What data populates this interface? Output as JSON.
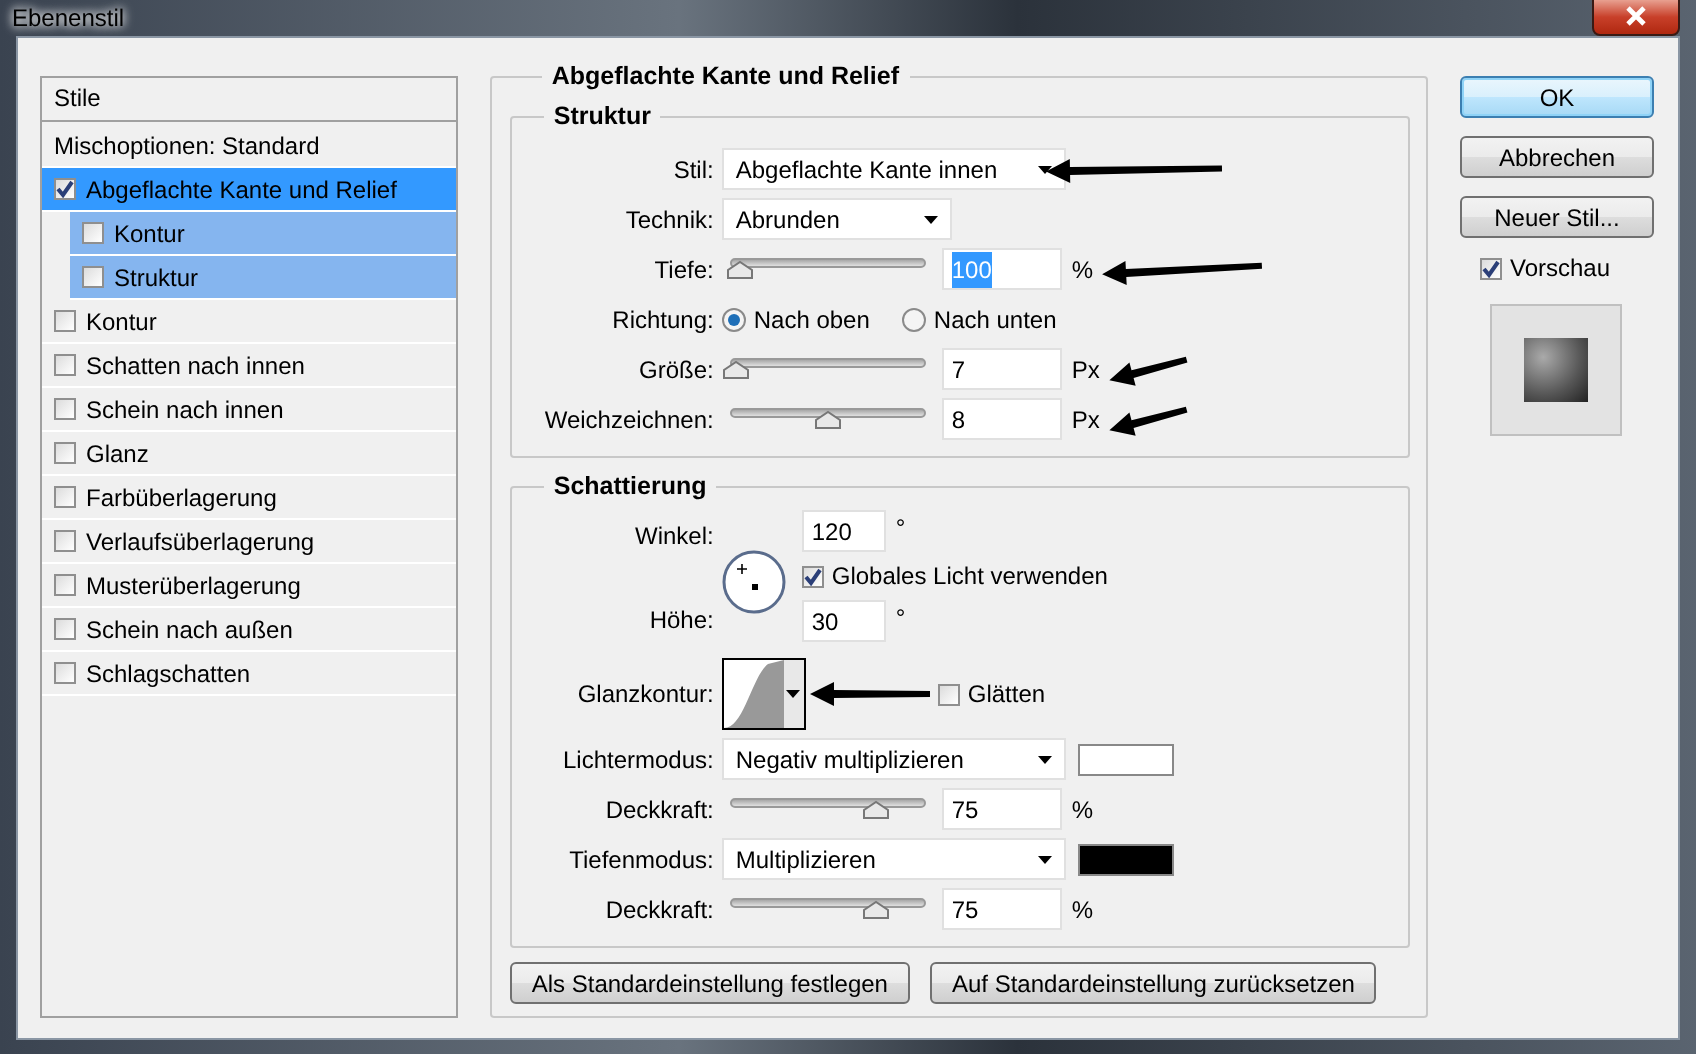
{
  "window": {
    "title": "Ebenenstil"
  },
  "styles_panel": {
    "header": "Stile",
    "items": [
      {
        "label": "Mischoptionen: Standard",
        "kind": "plain",
        "selected": false
      },
      {
        "label": "Abgeflachte Kante und Relief",
        "kind": "check",
        "checked": true,
        "selected": true,
        "children": [
          {
            "label": "Kontur",
            "kind": "check",
            "checked": false,
            "selected": false
          },
          {
            "label": "Struktur",
            "kind": "check",
            "checked": false,
            "selected": false
          }
        ]
      },
      {
        "label": "Kontur",
        "kind": "check",
        "checked": false,
        "selected": false
      },
      {
        "label": "Schatten nach innen",
        "kind": "check",
        "checked": false,
        "selected": false
      },
      {
        "label": "Schein nach innen",
        "kind": "check",
        "checked": false,
        "selected": false
      },
      {
        "label": "Glanz",
        "kind": "check",
        "checked": false,
        "selected": false
      },
      {
        "label": "Farbüberlagerung",
        "kind": "check",
        "checked": false,
        "selected": false
      },
      {
        "label": "Verlaufsüberlagerung",
        "kind": "check",
        "checked": false,
        "selected": false
      },
      {
        "label": "Musterüberlagerung",
        "kind": "check",
        "checked": false,
        "selected": false
      },
      {
        "label": "Schein nach außen",
        "kind": "check",
        "checked": false,
        "selected": false
      },
      {
        "label": "Schlagschatten",
        "kind": "check",
        "checked": false,
        "selected": false
      }
    ]
  },
  "settings": {
    "title": "Abgeflachte Kante und Relief",
    "groups": [
      {
        "title": "Struktur",
        "rows": [
          {
            "kind": "select",
            "label": "Stil:",
            "value": "Abgeflachte Kante innen",
            "wide": true,
            "arrow": true
          },
          {
            "kind": "select",
            "label": "Technik:",
            "value": "Abrunden",
            "wide": false
          },
          {
            "kind": "slider",
            "label": "Tiefe:",
            "level": 0.05,
            "value": "100",
            "unit": "%",
            "value_selected": true,
            "arrow": true
          },
          {
            "kind": "radio",
            "label": "Richtung:",
            "options": [
              {
                "label": "Nach oben",
                "selected": true
              },
              {
                "label": "Nach unten",
                "selected": false
              }
            ]
          },
          {
            "kind": "slider",
            "label": "Größe:",
            "level": 0.03,
            "value": "7",
            "unit": "Px",
            "value_selected": false,
            "arrow": true
          },
          {
            "kind": "slider",
            "label": "Weichzeichnen:",
            "level": 0.5,
            "value": "8",
            "unit": "Px",
            "value_selected": false,
            "arrow": true
          }
        ]
      },
      {
        "title": "Schattierung",
        "rows": [
          {
            "kind": "angle",
            "label": "Winkel:",
            "value": "120",
            "unit": "°",
            "global_light": {
              "label": "Globales Licht verwenden",
              "checked": true
            },
            "height_label": "Höhe:",
            "height_value": "30",
            "height_unit": "°"
          },
          {
            "kind": "contour",
            "label": "Glanzkontur:",
            "smooth": {
              "label": "Glätten",
              "checked": false
            },
            "arrow": true
          },
          {
            "kind": "select",
            "label": "Lichtermodus:",
            "value": "Negativ multiplizieren",
            "wide": true,
            "color": "#ffffff"
          },
          {
            "kind": "slider",
            "label": "Deckkraft:",
            "level": 0.75,
            "value": "75",
            "unit": "%",
            "value_selected": false
          },
          {
            "kind": "select",
            "label": "Tiefenmodus:",
            "value": "Multiplizieren",
            "wide": true,
            "color": "#000000"
          },
          {
            "kind": "slider",
            "label": "Deckkraft:",
            "level": 0.75,
            "value": "75",
            "unit": "%",
            "value_selected": false
          }
        ]
      }
    ],
    "buttons": [
      "Als Standardeinstellung festlegen",
      "Auf Standardeinstellung zurücksetzen"
    ]
  },
  "actions": {
    "buttons": [
      {
        "label": "OK",
        "default": true
      },
      {
        "label": "Abbrechen",
        "default": false
      },
      {
        "label": "Neuer Stil...",
        "default": false
      }
    ],
    "preview": {
      "label": "Vorschau",
      "checked": true
    }
  }
}
